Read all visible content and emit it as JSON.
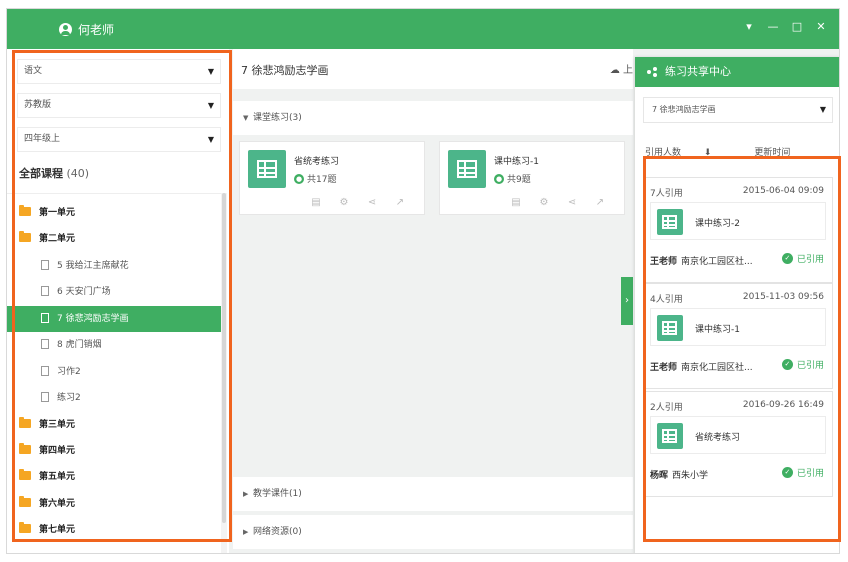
{
  "titlebar": {
    "user_name": "何老师",
    "controls": [
      "▾",
      "—",
      "□",
      "✕"
    ]
  },
  "sidebar": {
    "subject": "语文",
    "publisher": "苏教版",
    "grade": "四年级上",
    "all_label": "全部课程",
    "all_count": "(40)",
    "tree": [
      {
        "label": "第一单元",
        "type": "unit"
      },
      {
        "label": "第二单元",
        "type": "unit"
      },
      {
        "label": "5 我给江主席献花",
        "type": "lesson"
      },
      {
        "label": "6 天安门广场",
        "type": "lesson"
      },
      {
        "label": "7 徐悲鸿励志学画",
        "type": "lesson",
        "active": true
      },
      {
        "label": "8 虎门销烟",
        "type": "lesson"
      },
      {
        "label": "习作2",
        "type": "lesson"
      },
      {
        "label": "练习2",
        "type": "lesson"
      },
      {
        "label": "第三单元",
        "type": "unit"
      },
      {
        "label": "第四单元",
        "type": "unit"
      },
      {
        "label": "第五单元",
        "type": "unit"
      },
      {
        "label": "第六单元",
        "type": "unit"
      },
      {
        "label": "第七单元",
        "type": "unit"
      }
    ]
  },
  "main": {
    "title": "7 徐悲鸿励志学画",
    "upload_label": "上",
    "sections": {
      "classroom": "课堂练习(3)",
      "courseware": "教学课件(1)",
      "resources": "网络资源(0)"
    },
    "cards": [
      {
        "name": "省统考练习",
        "count": "共17题"
      },
      {
        "name": "课中练习-1",
        "count": "共9题"
      }
    ]
  },
  "share_panel": {
    "title": "练习共享中心",
    "lesson_select": "7 徐悲鸿励志学画",
    "sort_by_cites": "引用人数",
    "sort_arrow": "⬇",
    "sort_by_time": "更新时间",
    "items": [
      {
        "cites": "7人引用",
        "date": "2015-06-04 09:09",
        "name": "课中练习-2",
        "teacher": "王老师",
        "school": "南京化工园区社...",
        "status": "已引用"
      },
      {
        "cites": "4人引用",
        "date": "2015-11-03 09:56",
        "name": "课中练习-1",
        "teacher": "王老师",
        "school": "南京化工园区社...",
        "status": "已引用"
      },
      {
        "cites": "2人引用",
        "date": "2016-09-26 16:49",
        "name": "省统考练习",
        "teacher": "杨晖",
        "school": "西朱小学",
        "status": "已引用"
      }
    ]
  },
  "colors": {
    "accent": "#3fae62",
    "highlight": "#f0641e",
    "folder": "#f5a623"
  }
}
